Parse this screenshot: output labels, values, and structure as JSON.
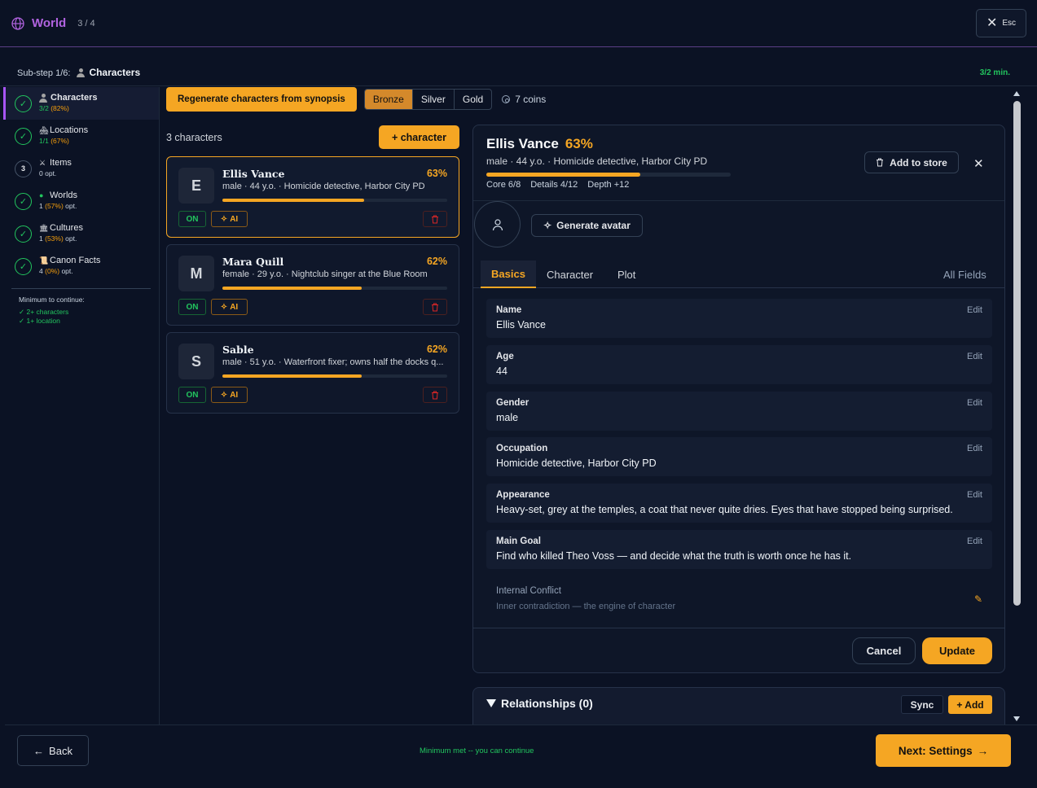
{
  "header": {
    "title": "World",
    "step_counter": "3 / 4",
    "close_label": "Esc"
  },
  "substep": {
    "label": "Sub-step 1/6:",
    "name": "Characters",
    "minimum": "3/2 min."
  },
  "steps": [
    {
      "title": "Characters",
      "count": "3/2",
      "pct": "(82%)",
      "suffix": "",
      "icon": "person-icon",
      "state": "done",
      "active": true
    },
    {
      "title": "Locations",
      "count": "1/1",
      "pct": "(67%)",
      "suffix": "",
      "icon": "house-icon",
      "state": "done",
      "active": false
    },
    {
      "title": "Items",
      "count": "0",
      "pct": "",
      "suffix": "opt.",
      "icon": "crossed-swords-icon",
      "state": "pending",
      "number": "3",
      "active": false
    },
    {
      "title": "Worlds",
      "count": "1",
      "pct": "(57%)",
      "suffix": "opt.",
      "icon": "globe-icon",
      "state": "done",
      "active": false
    },
    {
      "title": "Cultures",
      "count": "1",
      "pct": "(53%)",
      "suffix": "opt.",
      "icon": "temple-icon",
      "state": "done",
      "active": false
    },
    {
      "title": "Canon Facts",
      "count": "4",
      "pct": "(0%)",
      "suffix": "opt.",
      "icon": "scroll-icon",
      "state": "done",
      "active": false
    }
  ],
  "minimum_box": {
    "header": "Minimum to continue:",
    "items": [
      "2+ characters",
      "1+ location"
    ]
  },
  "toolbar": {
    "regenerate_label": "Regenerate characters from synopsis",
    "tiers": [
      "Bronze",
      "Silver",
      "Gold"
    ],
    "selected_tier": "Bronze",
    "coins": "7 coins"
  },
  "list": {
    "count_label": "3 characters",
    "add_label": "+ character"
  },
  "characters": [
    {
      "initial": "E",
      "name": "Ellis Vance",
      "pct": "63%",
      "progress": 0.63,
      "desc": "male · 44 y.o. · Homicide detective, Harbor City PD",
      "on": "ON",
      "ai": "AI",
      "selected": true
    },
    {
      "initial": "M",
      "name": "Mara Quill",
      "pct": "62%",
      "progress": 0.62,
      "desc": "female · 29 y.o. · Nightclub singer at the Blue Room",
      "on": "ON",
      "ai": "AI",
      "selected": false
    },
    {
      "initial": "S",
      "name": "Sable",
      "pct": "62%",
      "progress": 0.62,
      "desc": "male · 51 y.o. · Waterfront fixer; owns half the docks q...",
      "on": "ON",
      "ai": "AI",
      "selected": false
    }
  ],
  "detail": {
    "name": "Ellis Vance",
    "pct": "63%",
    "progress": 0.63,
    "meta": "male · 44 y.o. · Homicide detective, Harbor City PD",
    "stats": [
      "Core 6/8",
      "Details 4/12",
      "Depth +12"
    ],
    "store_label": "Add to store",
    "generate_avatar": "Generate avatar",
    "tabs": [
      "Basics",
      "Character",
      "Plot"
    ],
    "active_tab": "Basics",
    "all_fields": "All Fields",
    "edit_label": "Edit",
    "fields": [
      {
        "label": "Name",
        "value": "Ellis Vance"
      },
      {
        "label": "Age",
        "value": "44"
      },
      {
        "label": "Gender",
        "value": "male"
      },
      {
        "label": "Occupation",
        "value": "Homicide detective, Harbor City PD"
      },
      {
        "label": "Appearance",
        "value": "Heavy-set, grey at the temples, a coat that never quite dries. Eyes that have stopped being surprised."
      },
      {
        "label": "Main Goal",
        "value": "Find who killed Theo Voss — and decide what the truth is worth once he has it."
      }
    ],
    "empty_field": {
      "label": "Internal Conflict",
      "placeholder": "Inner contradiction — the engine of character"
    },
    "cancel_label": "Cancel",
    "update_label": "Update"
  },
  "relationships": {
    "title": "Relationships (0)",
    "sync_label": "Sync",
    "add_label": "+ Add"
  },
  "footer": {
    "back_label": "Back",
    "message": "Minimum met -- you can continue",
    "next_label": "Next: Settings"
  },
  "colors": {
    "accent": "#f5a623",
    "brand": "#b163e0",
    "success": "#22c55e",
    "background": "#0b1224"
  }
}
